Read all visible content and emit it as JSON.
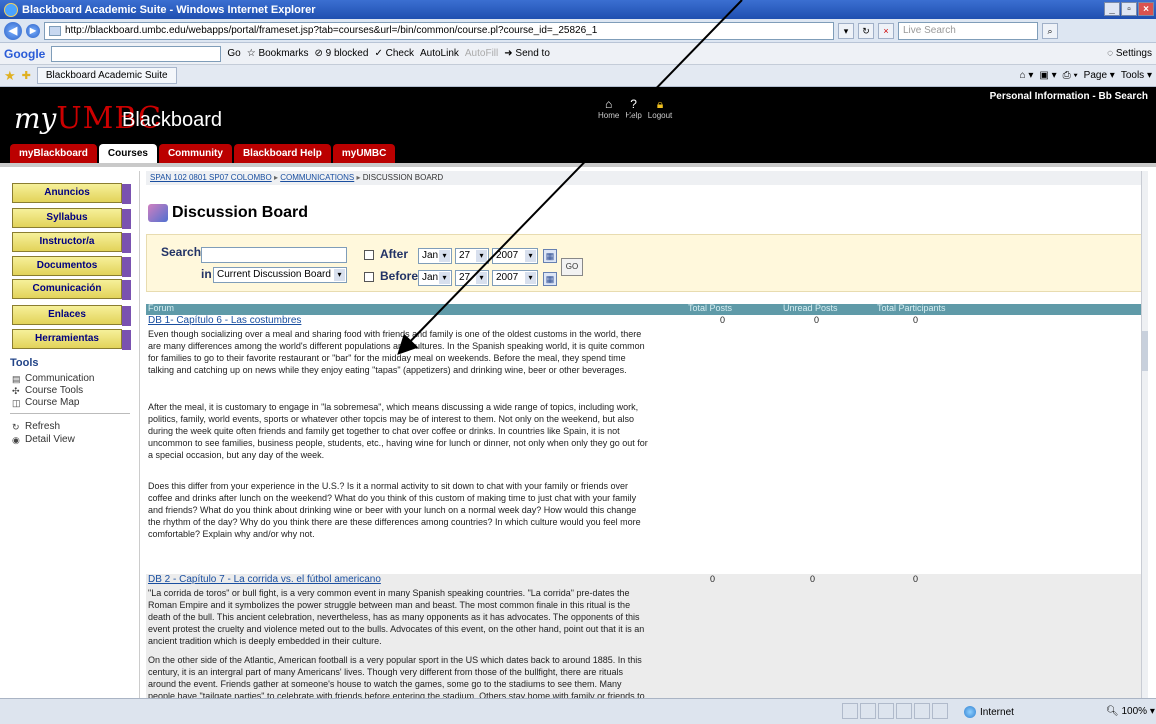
{
  "browser": {
    "title": "Blackboard Academic Suite - Windows Internet Explorer",
    "url": "http://blackboard.umbc.edu/webapps/portal/frameset.jsp?tab=courses&url=/bin/common/course.pl?course_id=_25826_1",
    "live_search_placeholder": "Live Search",
    "tab_label": "Blackboard Academic Suite",
    "google_label": "Google",
    "google_go": "Go",
    "google_bookmarks": "Bookmarks",
    "google_blocked": "9 blocked",
    "google_check": "Check",
    "google_autolink": "AutoLink",
    "google_autofill": "AutoFill",
    "google_sendto": "Send to",
    "google_settings": "Settings",
    "page_menu": "Page",
    "tools_menu": "Tools",
    "status_zone": "Internet",
    "zoom": "100%"
  },
  "header": {
    "brand_my": "my",
    "brand_umbc": "UMBC",
    "product": "Blackboard",
    "toplinks": "Personal Information   -   Bb Search",
    "icon_links": [
      {
        "label": "Home"
      },
      {
        "label": "Help"
      },
      {
        "label": "Logout"
      }
    ],
    "tabs": [
      {
        "label": "myBlackboard",
        "active": false
      },
      {
        "label": "Courses",
        "active": true
      },
      {
        "label": "Community",
        "active": false
      },
      {
        "label": "Blackboard Help",
        "active": false
      },
      {
        "label": "myUMBC",
        "active": false
      }
    ]
  },
  "leftnav": {
    "buttons": [
      {
        "label": "Anuncios"
      },
      {
        "label": "Syllabus"
      },
      {
        "label": "Instructor/a"
      },
      {
        "label": "Documentos"
      },
      {
        "label": "Comunicación"
      },
      {
        "label": "Enlaces"
      },
      {
        "label": "Herramientas"
      }
    ],
    "tools_title": "Tools",
    "tools": [
      {
        "label": "Communication"
      },
      {
        "label": "Course Tools"
      },
      {
        "label": "Course Map"
      }
    ],
    "actions": [
      {
        "label": "Refresh"
      },
      {
        "label": "Detail View"
      }
    ]
  },
  "breadcrumb": {
    "course": "SPAN 102 0801 SP07 COLOMBO",
    "section": "COMMUNICATIONS",
    "current": "DISCUSSION BOARD"
  },
  "page_title": "Discussion Board",
  "search": {
    "label": "Search",
    "in_label": "in",
    "scope": "Current Discussion Board",
    "after_label": "After",
    "before_label": "Before",
    "after_month": "Jan",
    "after_day": "27",
    "after_year": "2007",
    "before_month": "Jan",
    "before_day": "27",
    "before_year": "2007",
    "go_label": "GO"
  },
  "table": {
    "headers": [
      "Forum",
      "Total Posts",
      "Unread Posts",
      "Total Participants"
    ],
    "forums": [
      {
        "title": "DB 1- Capítulo 6 - Las costumbres",
        "total_posts": "0",
        "unread_posts": "0",
        "participants": "0",
        "paragraphs": [
          "Even though socializing over a meal and sharing food with friends and family is one of the oldest customs in the world, there are many differences among the world's different populations and cultures. In the Spanish speaking world, it is quite common for families to go to their favorite restaurant or \"bar\" for the midday meal on weekends. Before the meal, they spend time talking and catching up on news while they enjoy eating \"tapas\" (appetizers) and drinking wine, beer or other beverages.",
          "After the meal, it is customary to engage in \"la sobremesa\", which means discussing a wide range of topics, including work, politics, family, world events, sports or whatever other topcis may be of interest to them. Not only on the weekend, but also during the week quite often friends and family get together to chat over coffee or drinks. In countries like Spain, it is not uncommon to see families, business people, students, etc., having wine for lunch or dinner, not only when only they go out for a special occasion, but any day of the week.",
          "Does this differ from your experience in the U.S.? Is it a normal activity to sit down to chat with your family or friends over coffee and drinks after lunch on the weekend? What do you think of this custom of making time to just chat with your family and friends? What do you think about drinking wine or beer with your lunch on a normal week day? How would this change the rhythm of the day? Why do you think there are these differences among countries? In which culture would you feel more comfortable? Explain why and/or why not."
        ]
      },
      {
        "title": "DB 2 - Capítulo 7 - La corrida vs. el fútbol americano",
        "total_posts": "0",
        "unread_posts": "0",
        "participants": "0",
        "paragraphs": [
          "\"La corrida de toros\" or bull fight, is a very common event in many Spanish speaking countries. \"La corrida\" pre-dates the Roman Empire and it symbolizes the power struggle between man and beast. The most common finale in this ritual is the death of the bull. This ancient celebration, nevertheless, has as many opponents as it has advocates. The opponents of this event protest the cruelty and violence meted out to the bulls. Advocates of this event, on the other hand, point out that it is an ancient tradition which is deeply embedded in their culture.",
          "On the other side of the Atlantic, American football is a very popular sport in the US which dates back to around 1885. In this century, it is an intergral part of many Americans' lives. Though very different from those of the bullfight, there are rituals around the event. Friends gather at someone's house to watch the games, some go to the stadiums to see them. Many people have \"tailgate parties\" to celebrate with friends before entering the stadium. Others stay home with family or friends to eat and enjoy watching their favorite team win, or lose. Many"
        ]
      }
    ]
  }
}
